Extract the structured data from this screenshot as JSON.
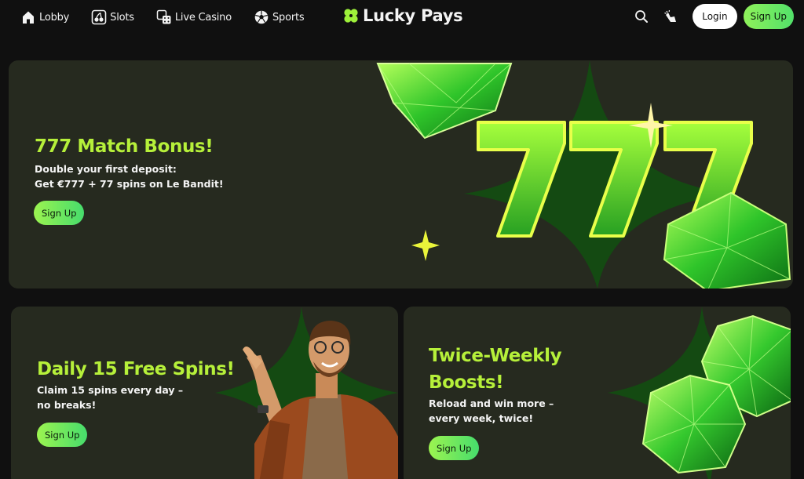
{
  "nav": {
    "items": [
      {
        "label": "Lobby",
        "icon": "home-icon"
      },
      {
        "label": "Slots",
        "icon": "cherries-icon"
      },
      {
        "label": "Live Casino",
        "icon": "dice-icon"
      },
      {
        "label": "Sports",
        "icon": "soccer-ball-icon"
      }
    ]
  },
  "logo": {
    "text": "Lucky Pays",
    "icon": "clover-icon"
  },
  "header": {
    "search_icon": "search-icon",
    "promo_icon": "bell-hand-icon",
    "login_label": "Login",
    "signup_label": "Sign Up"
  },
  "hero": {
    "title": "777 Match Bonus!",
    "line1": "Double your first deposit:",
    "line2": "Get €777 + 77 spins on Le Bandit!",
    "button": "Sign Up"
  },
  "card_left": {
    "title": "Daily 15 Free Spins!",
    "line1": "Claim 15 spins every day –",
    "line2": "no breaks!",
    "button": "Sign Up"
  },
  "card_right": {
    "title_line1": "Twice-Weekly",
    "title_line2": "Boosts!",
    "line1": "Reload and win more –",
    "line2": "every week, twice!",
    "button": "Sign Up"
  },
  "colors": {
    "accent": "#b6f03a",
    "button_green": "#6ee85e",
    "banner_bg": "#262a1f",
    "page_bg": "#101010"
  }
}
